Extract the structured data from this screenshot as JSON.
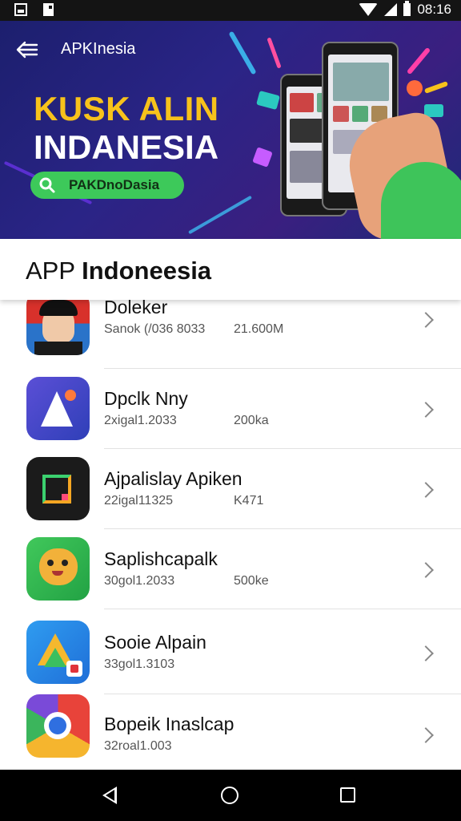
{
  "status_bar": {
    "time": "08:16"
  },
  "header": {
    "title": "APKInesia"
  },
  "banner": {
    "line1": "KUSK ALIN",
    "line2": "INDANESIA",
    "search_pill": "PAKDnoDasia"
  },
  "section": {
    "prefix": "APP",
    "title": "Indoneesia"
  },
  "apps": [
    {
      "name": "Doleker",
      "meta": "Sanok (/036 8033",
      "size": "21.600M"
    },
    {
      "name": "Dpclk Nny",
      "meta": "2xigal1.2033",
      "size": "200ka"
    },
    {
      "name": "Ajpalislay Apiken",
      "meta": "22igal11325",
      "size": "K471"
    },
    {
      "name": "Saplishcapalk",
      "meta": "30gol1.2033",
      "size": "500ke"
    },
    {
      "name": "Sooie Alpain",
      "meta": "33gol1.3103",
      "size": ""
    },
    {
      "name": "Bopeik Inaslcap",
      "meta": "32roal1.003",
      "size": ""
    }
  ],
  "icons": {
    "back": "back-arrow-icon",
    "search": "search-icon",
    "chevron": "chevron-right-icon",
    "nav": [
      "nav-back-icon",
      "nav-home-icon",
      "nav-recents-icon"
    ]
  },
  "colors": {
    "banner": "#2a2486",
    "promo_yellow": "#f7c21b",
    "pill_green": "#3dc95a",
    "status_bar": "#141414"
  }
}
